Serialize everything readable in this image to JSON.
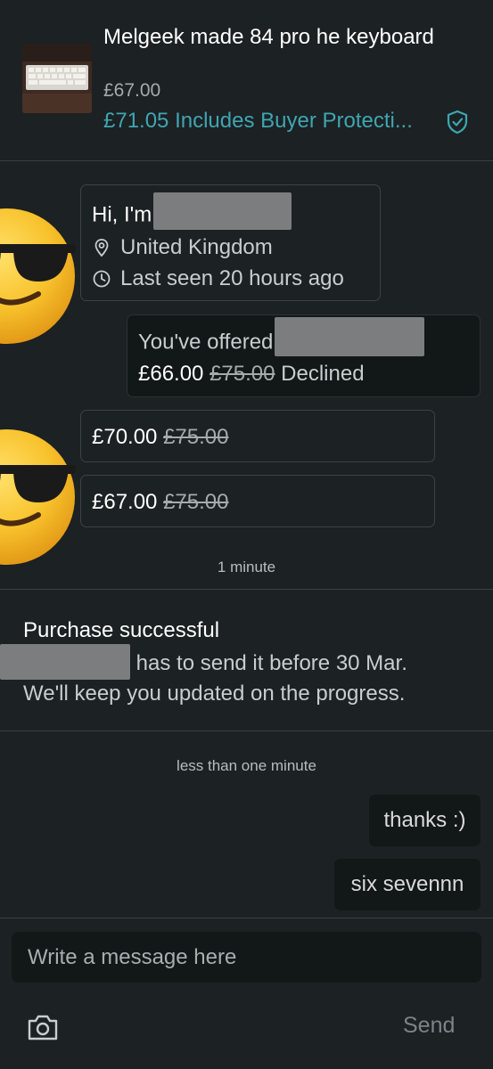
{
  "item": {
    "title": "Melgeek made 84 pro he keyboard",
    "price": "£67.00",
    "total": "£71.05 Includes Buyer Protecti...",
    "accent": "#3fa5b2"
  },
  "profile": {
    "greeting": "Hi, I'm",
    "location": "United Kingdom",
    "last_seen": "Last seen 20 hours ago"
  },
  "offer": {
    "prefix": "You've offered",
    "new_price": "£66.00",
    "old_price": "£75.00",
    "status": "Declined"
  },
  "counter_offers": [
    {
      "price": "£70.00",
      "old_price": "£75.00"
    },
    {
      "price": "£67.00",
      "old_price": "£75.00"
    }
  ],
  "time_1": "1 minute",
  "purchase": {
    "title": "Purchase successful",
    "line1": "has to send it before 30 Mar.",
    "line2": "We'll keep you updated on the progress."
  },
  "time_2": "less than one minute",
  "messages": [
    "thanks :)",
    "six sevennn"
  ],
  "composer": {
    "placeholder": "Write a message here",
    "send_label": "Send",
    "camera_icon": "camera-icon"
  }
}
